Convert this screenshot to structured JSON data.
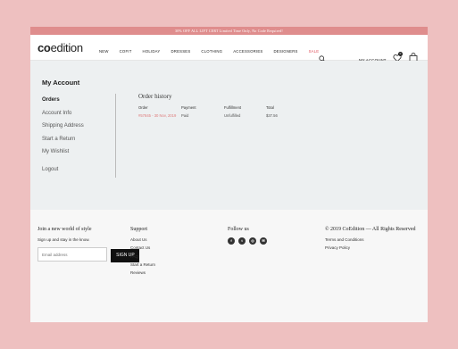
{
  "promo": "30% OFF ALL LIFT CERT Limited Time Only, No Code Required!",
  "logo": {
    "co": "co",
    "ed": "edition"
  },
  "nav": {
    "items": [
      "NEW",
      "COFIT",
      "HOLIDAY",
      "DRESSES",
      "CLOTHING",
      "ACCESSORIES",
      "DESIGNERS"
    ],
    "sale": "SALE",
    "account": "MY ACCOUNT",
    "cart_count": "0"
  },
  "account": {
    "title": "My Account",
    "menu": [
      "Orders",
      "Account Info",
      "Shipping Address",
      "Start a Return",
      "My Wishlist"
    ],
    "logout": "Logout"
  },
  "orders": {
    "title": "Order history",
    "headers": [
      "Order",
      "Payment",
      "Fulfillment",
      "Total"
    ],
    "rows": [
      [
        "#57845 - 30 Nov, 2019",
        "Paid",
        "Unfulfilled",
        "$37.56"
      ]
    ]
  },
  "footer": {
    "newsletter": {
      "title": "Join a new world of style",
      "text": "Sign up and stay in the know.",
      "placeholder": "Email address",
      "button": "SIGN UP"
    },
    "support": {
      "title": "Support",
      "links": [
        "About Us",
        "Contact Us",
        "FAQ",
        "Start a Return",
        "Reviews"
      ]
    },
    "follow": {
      "title": "Follow us",
      "icons": [
        "facebook-icon",
        "twitter-icon",
        "instagram-icon",
        "email-icon"
      ],
      "glyphs": [
        "f",
        "t",
        "◎",
        "✉"
      ]
    },
    "legal": {
      "copyright": "© 2019 CoEdition — All Rights Reserved",
      "links": [
        "Terms and Conditions",
        "Privacy Policy"
      ]
    }
  },
  "colors": {
    "accent": "#df8d8d",
    "sale": "#e0505a",
    "background": "#eec0c0",
    "panel": "#edf0f1"
  }
}
